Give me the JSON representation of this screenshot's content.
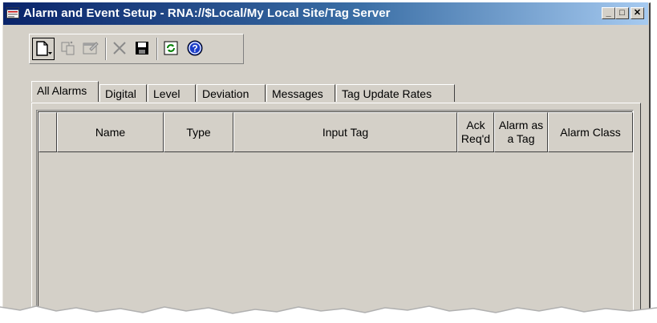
{
  "window": {
    "title": "Alarm and Event Setup - RNA://$Local/My Local Site/Tag Server",
    "controls": {
      "minimize": "_",
      "maximize": "□",
      "close": "✕"
    }
  },
  "toolbar": {
    "buttons": [
      {
        "name": "new",
        "icon": "new-document-dropdown-icon",
        "pressed": true,
        "enabled": true
      },
      {
        "name": "copy",
        "icon": "copy-icon",
        "enabled": false
      },
      {
        "name": "properties",
        "icon": "properties-icon",
        "enabled": false
      },
      {
        "name": "delete",
        "icon": "delete-icon",
        "enabled": false
      },
      {
        "name": "save",
        "icon": "save-icon",
        "enabled": true
      },
      {
        "name": "refresh",
        "icon": "refresh-icon",
        "enabled": true
      },
      {
        "name": "help",
        "icon": "help-icon",
        "enabled": true
      }
    ]
  },
  "tabs": [
    {
      "label": "All Alarms",
      "active": true
    },
    {
      "label": "Digital"
    },
    {
      "label": "Level"
    },
    {
      "label": "Deviation"
    },
    {
      "label": "Messages"
    },
    {
      "label": "Tag Update Rates"
    }
  ],
  "table": {
    "columns": [
      "Name",
      "Type",
      "Input Tag",
      "Ack Req'd",
      "Alarm as a Tag",
      "Alarm Class"
    ],
    "rows": []
  },
  "colors": {
    "title_start": "#0a246a",
    "title_end": "#a6caf0",
    "face": "#d4d0c8"
  }
}
